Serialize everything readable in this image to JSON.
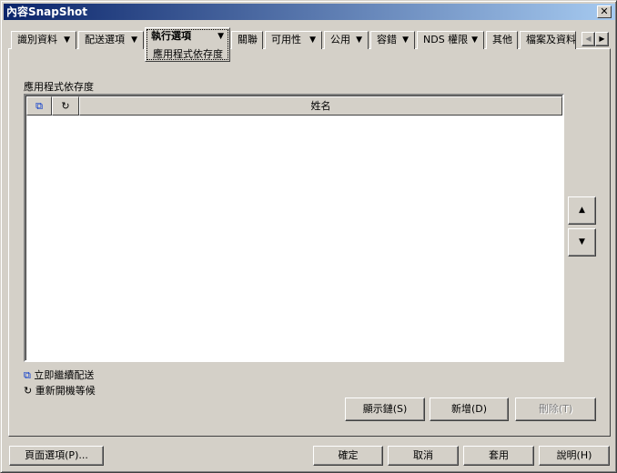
{
  "window": {
    "title": "內容SnapShot",
    "close": "✕"
  },
  "tabs": [
    {
      "label": "識別資料",
      "dropdown": true
    },
    {
      "label": "配送選項",
      "dropdown": true
    },
    {
      "label": "執行選項",
      "dropdown": true,
      "selected": true,
      "subpage": "應用程式依存度"
    },
    {
      "label": "關聯",
      "dropdown": false
    },
    {
      "label": "可用性",
      "dropdown": true
    },
    {
      "label": "公用",
      "dropdown": true
    },
    {
      "label": "容錯",
      "dropdown": true
    },
    {
      "label": "NDS 權限",
      "dropdown": true
    },
    {
      "label": "其他",
      "dropdown": false
    },
    {
      "label": "檔案及資料",
      "dropdown": false
    }
  ],
  "section": {
    "label": "應用程式依存度"
  },
  "table": {
    "columns": [
      "",
      "",
      "姓名"
    ],
    "rows": []
  },
  "legend": [
    {
      "icon": "chain-continue-icon",
      "label": "立即繼續配送"
    },
    {
      "icon": "reboot-wait-icon",
      "label": "重新開機等候"
    }
  ],
  "actions": {
    "show_chain": "顯示鏈(S)",
    "add": "新增(D)",
    "delete": "刪除(T)"
  },
  "footer": {
    "page_options": "頁面選項(P)...",
    "ok": "確定",
    "cancel": "取消",
    "apply": "套用",
    "help": "說明(H)"
  }
}
